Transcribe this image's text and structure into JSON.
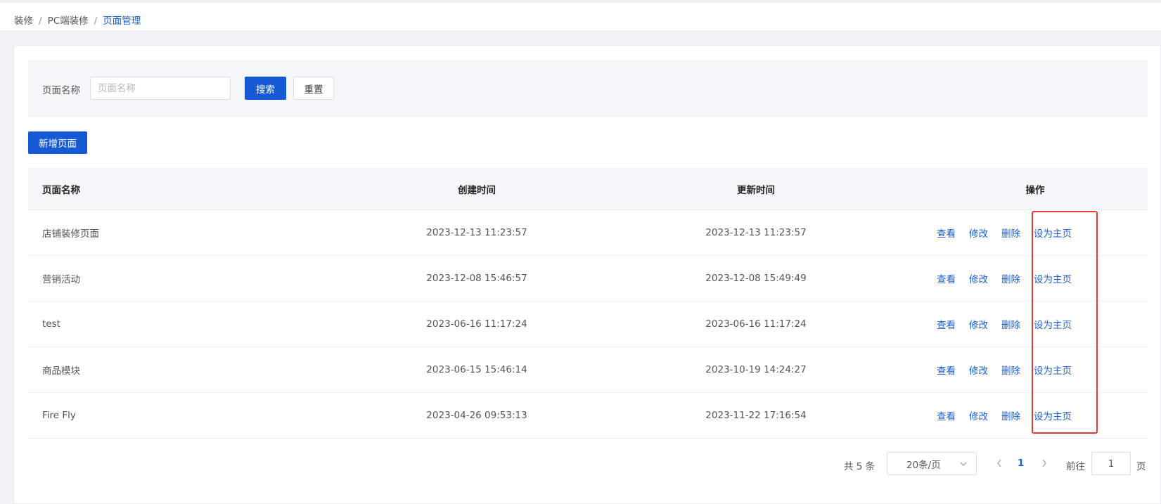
{
  "breadcrumb": {
    "items": [
      "装修",
      "PC端装修",
      "页面管理"
    ],
    "separator": "/"
  },
  "search": {
    "label": "页面名称",
    "placeholder": "页面名称",
    "value": "",
    "search_label": "搜索",
    "reset_label": "重置"
  },
  "toolbar": {
    "add_label": "新增页面"
  },
  "table": {
    "columns": [
      "页面名称",
      "创建时间",
      "更新时间",
      "操作"
    ],
    "actions": [
      "查看",
      "修改",
      "删除",
      "设为主页"
    ],
    "rows": [
      {
        "name": "店铺装修页面",
        "created": "2023-12-13 11:23:57",
        "updated": "2023-12-13 11:23:57"
      },
      {
        "name": "营销活动",
        "created": "2023-12-08 15:46:57",
        "updated": "2023-12-08 15:49:49"
      },
      {
        "name": "test",
        "created": "2023-06-16 11:17:24",
        "updated": "2023-06-16 11:17:24"
      },
      {
        "name": "商品模块",
        "created": "2023-06-15 15:46:14",
        "updated": "2023-10-19 14:24:27"
      },
      {
        "name": "Fire Fly",
        "created": "2023-04-26 09:53:13",
        "updated": "2023-11-22 17:16:54"
      }
    ]
  },
  "pagination": {
    "total_text": "共 5 条",
    "page_size": "20条/页",
    "current_page": "1",
    "goto_label": "前往",
    "goto_value": "1",
    "page_unit": "页"
  },
  "colors": {
    "primary": "#1559d4",
    "link": "#1a5fd6",
    "highlight": "#e53935"
  },
  "icons": {
    "select_arrow": "chevron-down-icon",
    "prev": "chevron-left-icon",
    "next": "chevron-right-icon"
  }
}
